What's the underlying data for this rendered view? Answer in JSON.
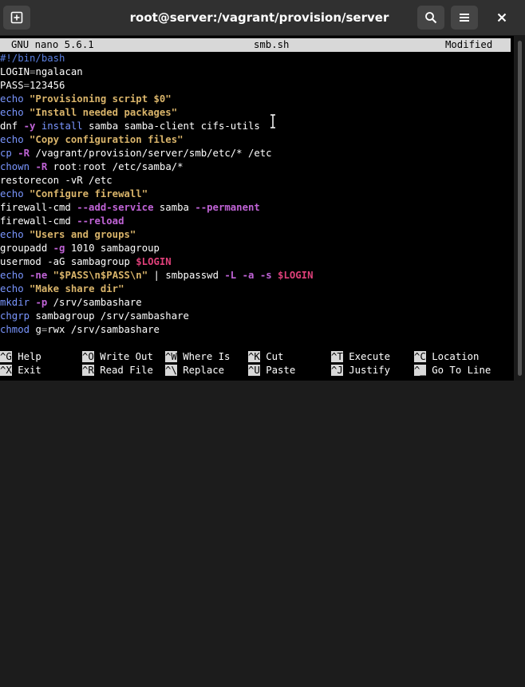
{
  "window": {
    "title": "root@server:/vagrant/provision/server",
    "new_tab_icon": "new-tab-icon",
    "search_icon": "search-icon",
    "menu_icon": "hamburger-menu-icon",
    "close_icon": "close-icon"
  },
  "nano": {
    "version": "GNU nano 5.6.1",
    "filename": "smb.sh",
    "status": "Modified"
  },
  "code": {
    "l1": "#!/bin/bash",
    "l2_a": "LOGIN",
    "l2_b": "=",
    "l2_c": "ngalacan",
    "l3_a": "PASS",
    "l3_b": "=",
    "l3_c": "123456",
    "l4_a": "echo",
    "l4_b": "\"Provisioning script $0\"",
    "l5_a": "echo",
    "l5_b": "\"Install needed packages\"",
    "l6_a": "dnf",
    "l6_b": "-y",
    "l6_c": "install",
    "l6_d": "samba samba-client cifs-utils",
    "l7_a": "echo",
    "l7_b": "\"Copy configuration files\"",
    "l8_a": "cp",
    "l8_b": "-R",
    "l8_c": "/vagrant/provision/server/smb/etc/* /etc",
    "l9_a": "chown",
    "l9_b": "-R",
    "l9_c": "root",
    "l9_d": ":",
    "l9_e": "root /etc/samba/*",
    "l10": "restorecon -vR /etc",
    "l11_a": "echo",
    "l11_b": "\"Configure firewall\"",
    "l12_a": "firewall-cmd",
    "l12_b": "--add-service",
    "l12_c": "samba",
    "l12_d": "--permanent",
    "l13_a": "firewall-cmd",
    "l13_b": "--reload",
    "l14_a": "echo",
    "l14_b": "\"Users and groups\"",
    "l15_a": "groupadd",
    "l15_b": "-g",
    "l15_c": "1010 sambagroup",
    "l16_a": "usermod -aG sambagroup",
    "l16_b": "$LOGIN",
    "l17_a": "echo",
    "l17_b": "-ne",
    "l17_c": "\"$PASS\\n$PASS\\n\"",
    "l17_d": "|",
    "l17_e": "smbpasswd",
    "l17_f": "-L",
    "l17_g": "-a",
    "l17_h": "-s",
    "l17_i": "$LOGIN",
    "l18_a": "echo",
    "l18_b": "\"Make share dir\"",
    "l19_a": "mkdir",
    "l19_b": "-p",
    "l19_c": "/srv/sambashare",
    "l20_a": "chgrp",
    "l20_b": "sambagroup /srv/sambashare",
    "l21_a": "chmod",
    "l21_b": "g",
    "l21_c": "=",
    "l21_d": "rwx /srv/sambashare"
  },
  "shortcuts": [
    {
      "key": "^G",
      "label": "Help"
    },
    {
      "key": "^O",
      "label": "Write Out"
    },
    {
      "key": "^W",
      "label": "Where Is"
    },
    {
      "key": "^K",
      "label": "Cut"
    },
    {
      "key": "^T",
      "label": "Execute"
    },
    {
      "key": "^C",
      "label": "Location"
    },
    {
      "key": "^X",
      "label": "Exit"
    },
    {
      "key": "^R",
      "label": "Read File"
    },
    {
      "key": "^\\",
      "label": "Replace"
    },
    {
      "key": "^U",
      "label": "Paste"
    },
    {
      "key": "^J",
      "label": "Justify"
    },
    {
      "key": "^_",
      "label": "Go To Line"
    }
  ]
}
